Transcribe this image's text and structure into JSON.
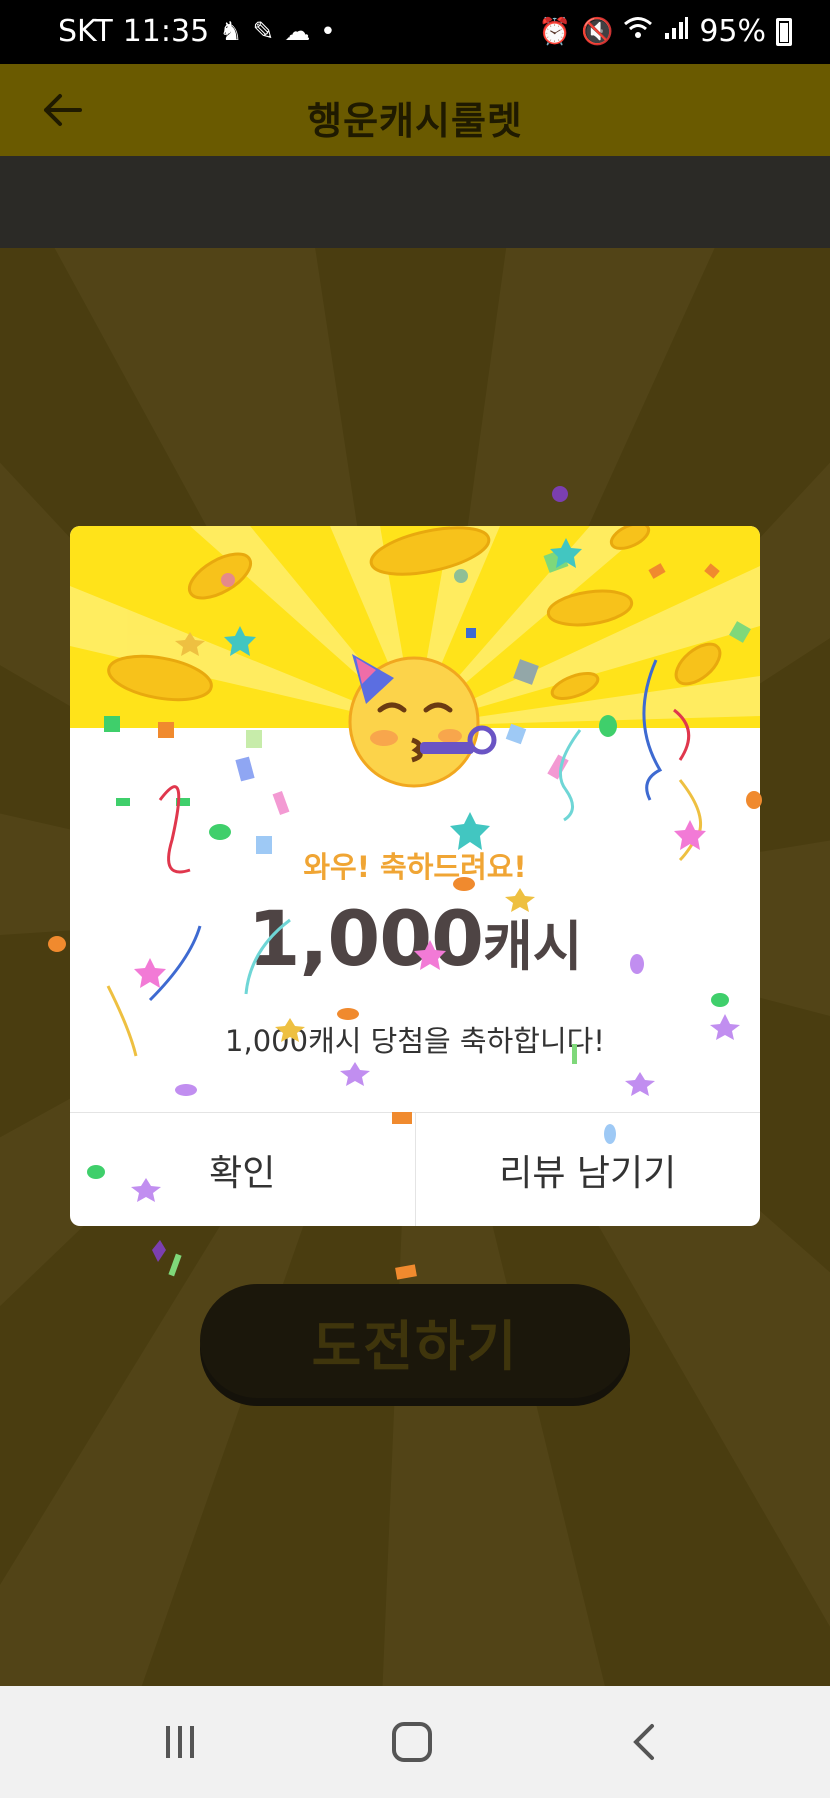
{
  "status_bar": {
    "carrier": "SKT",
    "time": "11:35",
    "battery": "95%",
    "left_icons": [
      "person-icon",
      "pen-icon",
      "cloud-icon",
      "dot-icon"
    ],
    "right_icons": [
      "alarm-icon",
      "mute-icon",
      "wifi-icon",
      "signal-icon",
      "battery-icon"
    ]
  },
  "header": {
    "title": "행운캐시룰렛",
    "back_icon": "arrow-left-icon"
  },
  "main": {
    "challenge_label": "도전하기"
  },
  "modal": {
    "subtitle": "와우! 축하드려요!",
    "prize_amount": "1,000",
    "prize_unit": "캐시",
    "message": "1,000캐시 당첨을 축하합니다!",
    "confirm_label": "확인",
    "review_label": "리뷰 남기기",
    "emoji_icon": "partying-face-icon"
  },
  "nav": {
    "icons": [
      "recent-apps-icon",
      "home-icon",
      "back-icon"
    ]
  },
  "colors": {
    "banner_yellow": "#ffe31a",
    "subtitle_orange": "#f0a534",
    "prize_text": "#4e4444",
    "dim_background": "#4a3d10"
  }
}
